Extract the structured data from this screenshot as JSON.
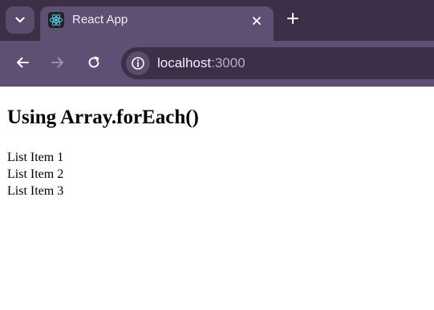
{
  "browser": {
    "tab": {
      "title": "React App",
      "favicon": "react-logo-icon",
      "close_icon": "close-icon"
    },
    "tab_search_icon": "chevron-down-icon",
    "new_tab_icon": "plus-icon",
    "toolbar": {
      "back_icon": "arrow-left-icon",
      "forward_icon": "arrow-right-icon",
      "reload_icon": "reload-icon",
      "site_info_icon": "info-icon",
      "url_host": "localhost",
      "url_port": ":3000"
    },
    "colors": {
      "tabstrip": "#3b3047",
      "active_tab": "#5e5072",
      "omnibox": "#3b3047",
      "react_blue": "#61dafb"
    }
  },
  "page": {
    "heading": "Using Array.forEach()",
    "items": [
      "List Item 1",
      "List Item 2",
      "List Item 3"
    ]
  }
}
